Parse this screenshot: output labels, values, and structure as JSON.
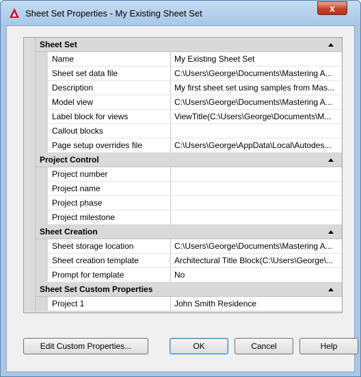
{
  "window": {
    "title": "Sheet Set Properties - My Existing Sheet Set",
    "close_label": "x"
  },
  "groups": [
    {
      "header": "Sheet Set",
      "rows": [
        {
          "name": "Name",
          "value": "My Existing Sheet Set"
        },
        {
          "name": "Sheet set data file",
          "value": "C:\\Users\\George\\Documents\\Mastering A..."
        },
        {
          "name": "Description",
          "value": "My first sheet set using samples from Mas..."
        },
        {
          "name": "Model view",
          "value": "C:\\Users\\George\\Documents\\Mastering A..."
        },
        {
          "name": "Label block for views",
          "value": "ViewTitle(C:\\Users\\George\\Documents\\M..."
        },
        {
          "name": "Callout blocks",
          "value": ""
        },
        {
          "name": "Page setup overrides file",
          "value": "C:\\Users\\George\\AppData\\Local\\Autodes..."
        }
      ]
    },
    {
      "header": "Project Control",
      "rows": [
        {
          "name": "Project number",
          "value": ""
        },
        {
          "name": "Project name",
          "value": ""
        },
        {
          "name": "Project phase",
          "value": ""
        },
        {
          "name": "Project milestone",
          "value": ""
        }
      ]
    },
    {
      "header": "Sheet Creation",
      "rows": [
        {
          "name": "Sheet storage location",
          "value": "C:\\Users\\George\\Documents\\Mastering A..."
        },
        {
          "name": "Sheet creation template",
          "value": "Architectural Title Block(C:\\Users\\George\\..."
        },
        {
          "name": "Prompt for template",
          "value": "No"
        }
      ]
    },
    {
      "header": "Sheet Set Custom Properties",
      "rows": [
        {
          "name": "Project 1",
          "value": "John Smith Residence"
        }
      ]
    }
  ],
  "buttons": {
    "edit_custom": "Edit Custom Properties...",
    "ok": "OK",
    "cancel": "Cancel",
    "help": "Help"
  }
}
